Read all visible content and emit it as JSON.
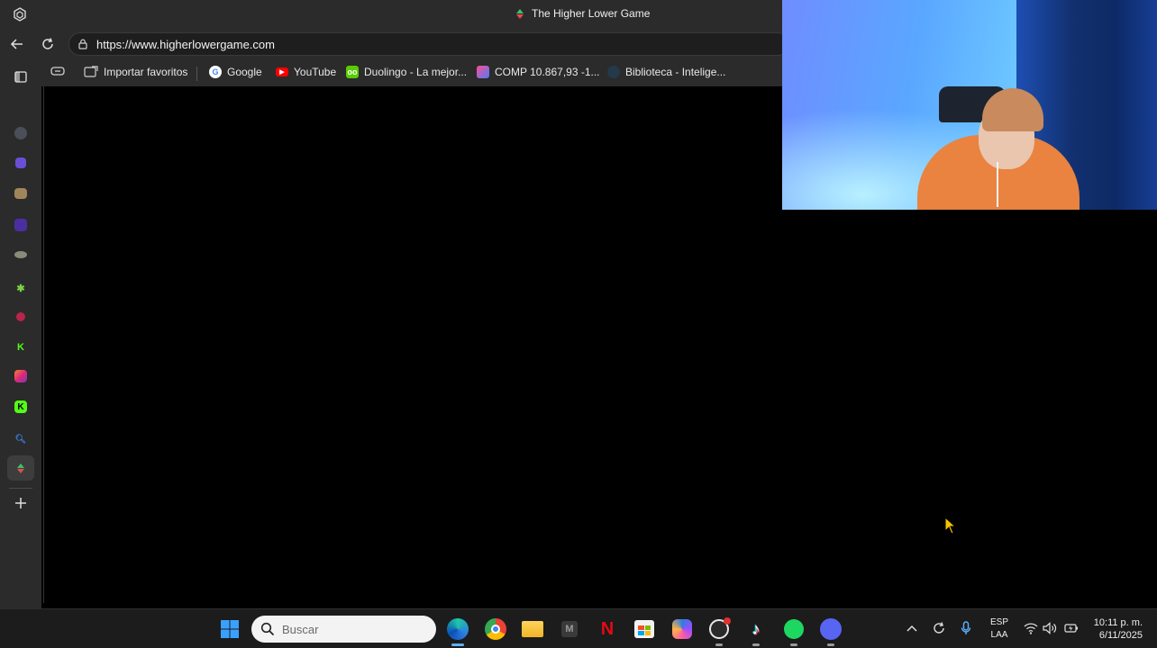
{
  "browser": {
    "tab_title": "The Higher Lower Game",
    "url": "https://www.higherlowergame.com"
  },
  "favorites": [
    {
      "label": "Importar favoritos",
      "icon": "import-favorites-icon"
    },
    {
      "label": "Google",
      "icon": "google-icon"
    },
    {
      "label": "YouTube",
      "icon": "youtube-icon"
    },
    {
      "label": "Duolingo - La mejor...",
      "icon": "duolingo-icon"
    },
    {
      "label": "COMP 10.867,93 -1...",
      "icon": "comp-icon"
    },
    {
      "label": "Biblioteca - Intelige...",
      "icon": "library-icon"
    }
  ],
  "sidebar": {
    "icons": [
      "chat-icon",
      "app-icon",
      "notes-icon",
      "app-icon",
      "app-icon",
      "green-app-icon",
      "red-app-icon",
      "kick-icon",
      "instagram-icon",
      "kick-icon",
      "search-icon",
      "higher-lower-icon",
      "add-icon"
    ],
    "kick_letter": "K"
  },
  "taskbar": {
    "search_placeholder": "Buscar",
    "apps": [
      "windows-start-icon",
      "edge-icon",
      "chrome-icon",
      "file-explorer-icon",
      "m-app-icon",
      "netflix-icon",
      "store-icon",
      "copilot-icon",
      "obs-icon",
      "tiktok-icon",
      "spotify-icon",
      "discord-icon"
    ],
    "lang_top": "ESP",
    "lang_bottom": "LAA",
    "time": "10:11 p. m.",
    "date": "6/11/2025"
  },
  "colors": {
    "chrome_bg": "#2b2b2b",
    "content_bg": "#000000",
    "taskbar_bg": "#1c1c1c"
  }
}
